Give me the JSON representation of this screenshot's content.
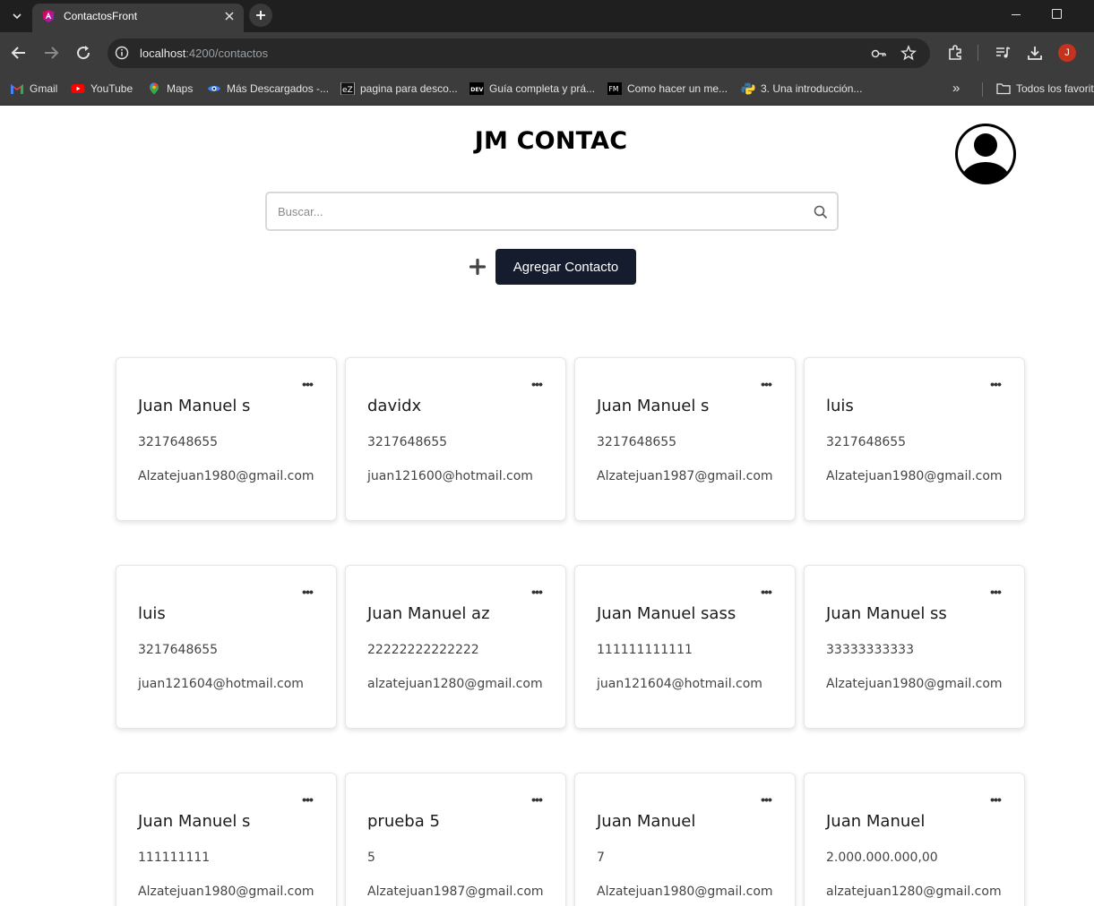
{
  "browser": {
    "tab_title": "ContactosFront",
    "url_host": "localhost",
    "url_rest": ":4200/contactos",
    "profile_initial": "J",
    "bookmarks": [
      {
        "label": "Gmail",
        "icon": "gmail-icon"
      },
      {
        "label": "YouTube",
        "icon": "youtube-icon"
      },
      {
        "label": "Maps",
        "icon": "maps-icon"
      },
      {
        "label": "Más Descargados -...",
        "icon": "eye-icon"
      },
      {
        "label": "pagina para desco...",
        "icon": "ez-icon"
      },
      {
        "label": "Guía completa y prá...",
        "icon": "dev-icon"
      },
      {
        "label": "Como hacer un me...",
        "icon": "fm-icon"
      },
      {
        "label": "3. Una introducción...",
        "icon": "python-icon"
      }
    ],
    "other_bookmarks": "Todos los favoritos",
    "colors": {
      "tabbar": "#1f1f1f",
      "toolbar": "#3c3c3c",
      "profile": "#c5321e"
    }
  },
  "app": {
    "title": "JM CONTAC",
    "search_placeholder": "Buscar...",
    "add_label": "Agregar Contacto",
    "menu_glyph": "•••",
    "colors": {
      "primary_button": "#151c2e"
    }
  },
  "contacts": [
    {
      "name": "Juan Manuel s",
      "phone": "3217648655",
      "email": "Alzatejuan1980@gmail.com"
    },
    {
      "name": "davidx",
      "phone": "3217648655",
      "email": "juan121600@hotmail.com"
    },
    {
      "name": "Juan Manuel s",
      "phone": "3217648655",
      "email": "Alzatejuan1987@gmail.com"
    },
    {
      "name": "luis",
      "phone": "3217648655",
      "email": "Alzatejuan1980@gmail.com"
    },
    {
      "name": "luis",
      "phone": "3217648655",
      "email": "juan121604@hotmail.com"
    },
    {
      "name": "Juan Manuel az",
      "phone": "22222222222222",
      "email": "alzatejuan1280@gmail.com"
    },
    {
      "name": "Juan Manuel sass",
      "phone": "111111111111",
      "email": "juan121604@hotmail.com"
    },
    {
      "name": "Juan Manuel ss",
      "phone": "33333333333",
      "email": "Alzatejuan1980@gmail.com"
    },
    {
      "name": "Juan Manuel s",
      "phone": "111111111",
      "email": "Alzatejuan1980@gmail.com"
    },
    {
      "name": "prueba 5",
      "phone": "5",
      "email": "Alzatejuan1987@gmail.com"
    },
    {
      "name": "Juan Manuel",
      "phone": "7",
      "email": "Alzatejuan1980@gmail.com"
    },
    {
      "name": "Juan Manuel",
      "phone": "2.000.000.000,00",
      "email": "alzatejuan1280@gmail.com"
    }
  ]
}
